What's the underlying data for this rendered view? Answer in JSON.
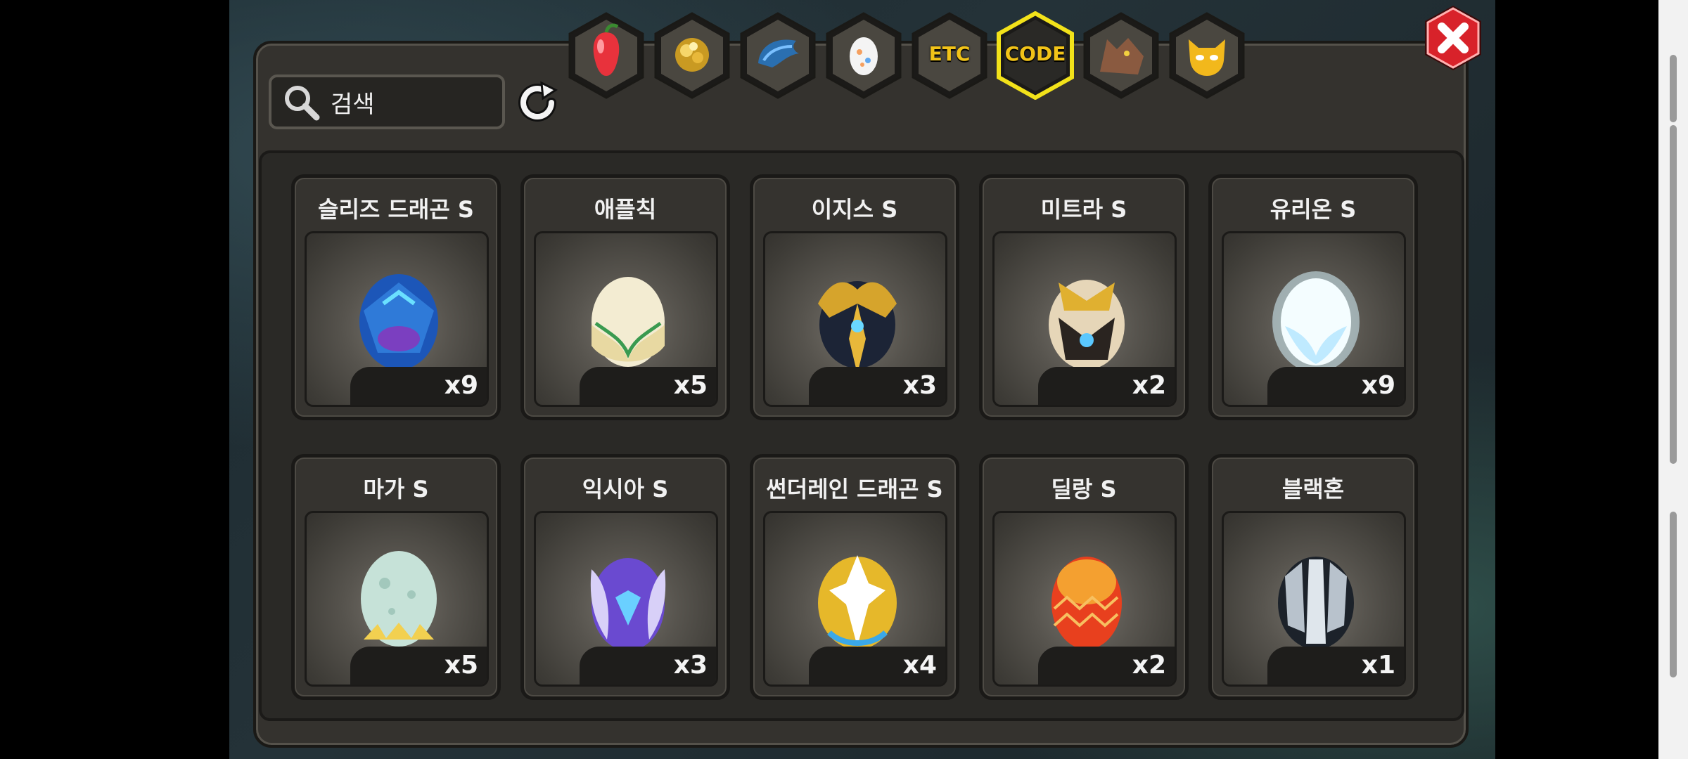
{
  "search": {
    "placeholder": "검색"
  },
  "tabs": [
    {
      "id": "fruit",
      "icon": "red-fruit-icon",
      "label": ""
    },
    {
      "id": "material",
      "icon": "gold-nugget-icon",
      "label": ""
    },
    {
      "id": "dragon",
      "icon": "blue-dragon-icon",
      "label": ""
    },
    {
      "id": "egg",
      "icon": "egg-icon",
      "label": ""
    },
    {
      "id": "etc",
      "icon": "",
      "label": "ETC"
    },
    {
      "id": "code",
      "icon": "",
      "label": "CODE",
      "selected": true
    },
    {
      "id": "beast",
      "icon": "wolf-icon",
      "label": ""
    },
    {
      "id": "monster",
      "icon": "horned-face-icon",
      "label": ""
    }
  ],
  "colors": {
    "accent_selected": "#f2e21a",
    "tab_label": "#f2c318",
    "close_red": "#d8222a"
  },
  "items": [
    {
      "name": "슬리즈 드래곤 S",
      "qty": "x9",
      "icon": "blue-armored-egg-icon"
    },
    {
      "name": "애플칙",
      "qty": "x5",
      "icon": "cream-feathered-egg-icon"
    },
    {
      "name": "이지스 S",
      "qty": "x3",
      "icon": "dark-gold-horned-egg-icon"
    },
    {
      "name": "미트라 S",
      "qty": "x2",
      "icon": "ornate-gold-egg-icon"
    },
    {
      "name": "유리온 S",
      "qty": "x9",
      "icon": "glowing-white-egg-icon"
    },
    {
      "name": "마가 S",
      "qty": "x5",
      "icon": "mint-spotted-egg-icon"
    },
    {
      "name": "익시아 S",
      "qty": "x3",
      "icon": "purple-winged-egg-icon"
    },
    {
      "name": "썬더레인 드래곤 S",
      "qty": "x4",
      "icon": "gold-white-dragon-egg-icon"
    },
    {
      "name": "딜랑 S",
      "qty": "x2",
      "icon": "red-orange-egg-icon"
    },
    {
      "name": "블랙혼",
      "qty": "x1",
      "icon": "silver-plated-egg-icon"
    }
  ]
}
